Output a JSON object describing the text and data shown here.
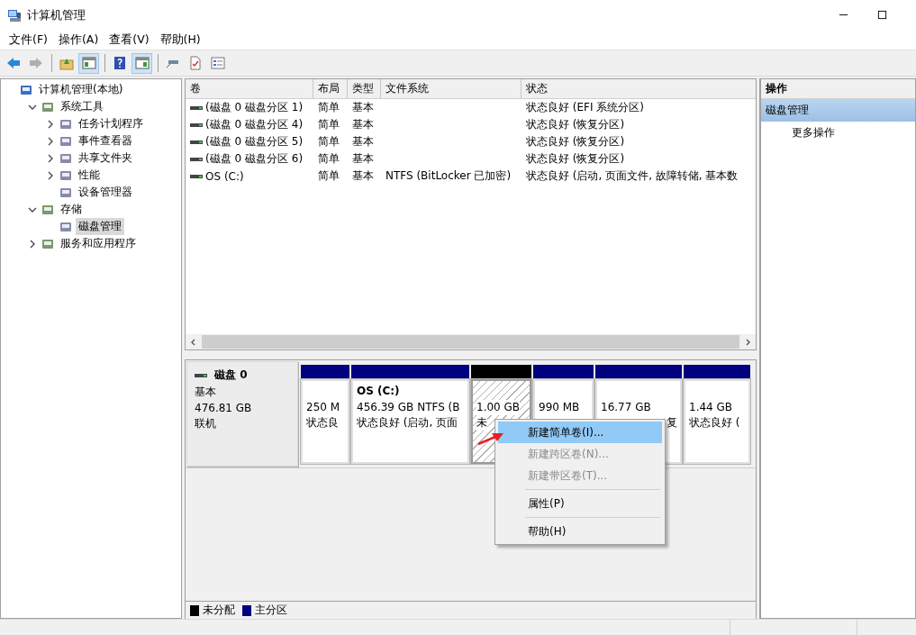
{
  "window": {
    "title": "计算机管理"
  },
  "menu": [
    "文件(F)",
    "操作(A)",
    "查看(V)",
    "帮助(H)"
  ],
  "toolbar": [
    {
      "pressed": false,
      "disabled": false
    },
    {
      "pressed": false,
      "disabled": true
    },
    {
      "pressed": false,
      "disabled": false
    },
    {
      "pressed": true,
      "disabled": false
    },
    {
      "pressed": false,
      "disabled": false
    },
    {
      "pressed": true,
      "disabled": false
    },
    {
      "pressed": false,
      "disabled": false
    },
    {
      "pressed": false,
      "disabled": false
    },
    {
      "pressed": false,
      "disabled": false
    }
  ],
  "tree": [
    {
      "label": "计算机管理(本地)",
      "selected": false,
      "children": [
        {
          "label": "系统工具",
          "selected": false,
          "expanded": true,
          "children": [
            {
              "label": "任务计划程序",
              "selected": false,
              "expanded": false
            },
            {
              "label": "事件查看器",
              "selected": false,
              "expanded": false
            },
            {
              "label": "共享文件夹",
              "selected": false,
              "expanded": false
            },
            {
              "label": "性能",
              "selected": false,
              "expanded": false
            },
            {
              "label": "设备管理器",
              "selected": false
            }
          ]
        },
        {
          "label": "存储",
          "selected": false,
          "expanded": true,
          "children": [
            {
              "label": "磁盘管理",
              "selected": true
            }
          ]
        },
        {
          "label": "服务和应用程序",
          "selected": false,
          "expanded": false
        }
      ]
    }
  ],
  "table": {
    "columns": [
      "卷",
      "布局",
      "类型",
      "文件系统",
      "状态"
    ],
    "rows": [
      {
        "cells": [
          "(磁盘 0 磁盘分区 1)",
          "简单",
          "基本",
          "",
          "状态良好 (EFI 系统分区)"
        ]
      },
      {
        "cells": [
          "(磁盘 0 磁盘分区 4)",
          "简单",
          "基本",
          "",
          "状态良好 (恢复分区)"
        ]
      },
      {
        "cells": [
          "(磁盘 0 磁盘分区 5)",
          "简单",
          "基本",
          "",
          "状态良好 (恢复分区)"
        ]
      },
      {
        "cells": [
          "(磁盘 0 磁盘分区 6)",
          "简单",
          "基本",
          "",
          "状态良好 (恢复分区)"
        ]
      },
      {
        "cells": [
          "OS (C:)",
          "简单",
          "基本",
          "NTFS (BitLocker 已加密)",
          "状态良好 (启动, 页面文件, 故障转储, 基本数"
        ]
      }
    ]
  },
  "disk": {
    "name": "磁盘 0",
    "type": "基本",
    "size": "476.81 GB",
    "status": "联机",
    "partitions": [
      {
        "kind": "primary",
        "lines": [
          "250 M",
          "状态良"
        ]
      },
      {
        "kind": "primary",
        "name": "OS  (C:)",
        "lines": [
          "456.39 GB NTFS (B",
          "状态良好 (启动, 页面"
        ]
      },
      {
        "kind": "unallocated",
        "lines": [
          "1.00 GB",
          "未"
        ]
      },
      {
        "kind": "primary",
        "lines": [
          "990 MB"
        ]
      },
      {
        "kind": "primary",
        "covered_by_menu": true,
        "lines": [
          "16.77 GB",
          "复"
        ]
      },
      {
        "kind": "primary",
        "lines": [
          "1.44 GB",
          "状态良好 ("
        ]
      }
    ]
  },
  "legend": [
    {
      "label": "未分配",
      "color": "#000000"
    },
    {
      "label": "主分区",
      "color": "#000080"
    }
  ],
  "actions": {
    "title": "操作",
    "section": "磁盘管理",
    "items": [
      "更多操作"
    ]
  },
  "context_menu": [
    {
      "items": [
        {
          "label": "新建简单卷(I)...",
          "selected": true,
          "disabled": false
        },
        {
          "label": "新建跨区卷(N)...",
          "selected": false,
          "disabled": true
        },
        {
          "label": "新建带区卷(T)...",
          "selected": false,
          "disabled": true
        }
      ]
    },
    {
      "items": [
        {
          "label": "属性(P)",
          "selected": false,
          "disabled": false
        }
      ]
    },
    {
      "items": [
        {
          "label": "帮助(H)",
          "selected": false,
          "disabled": false
        }
      ]
    }
  ]
}
